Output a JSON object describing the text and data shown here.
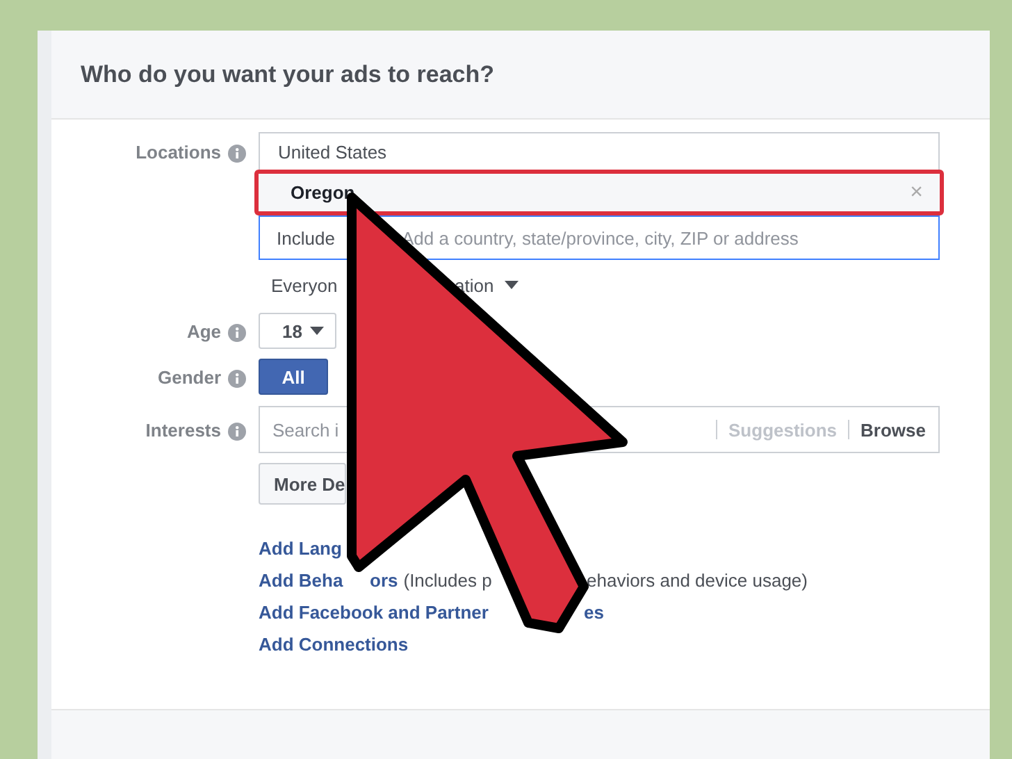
{
  "header": {
    "title": "Who do you want your ads to reach?"
  },
  "locations": {
    "label": "Locations",
    "country": "United States",
    "selected_location": {
      "name": "Oregon",
      "remove": "×",
      "highlighted": true
    },
    "include_select": "Include",
    "placeholder": "Add a country, state/province, city, ZIP or address",
    "audience_fragments": [
      "Everyon",
      "ation"
    ]
  },
  "age": {
    "label": "Age",
    "min_age": "18"
  },
  "gender": {
    "label": "Gender",
    "options": [
      {
        "label": "All",
        "selected": true
      }
    ]
  },
  "interests": {
    "label": "Interests",
    "placeholder": "Search i",
    "suggestions": "Suggestions",
    "browse": "Browse"
  },
  "more_button": "More De",
  "links": [
    {
      "fragments": [
        {
          "text": "Add Lang",
          "kind": "link"
        }
      ]
    },
    {
      "fragments": [
        {
          "text": "Add Beha",
          "kind": "link"
        },
        {
          "text": "ors",
          "kind": "link"
        },
        {
          "text": "(Includes p",
          "kind": "note"
        },
        {
          "text": "ehaviors and device usage)",
          "kind": "note"
        }
      ]
    },
    {
      "fragments": [
        {
          "text": "Add Facebook and Partner",
          "kind": "link"
        },
        {
          "text": "es",
          "kind": "link"
        }
      ]
    },
    {
      "fragments": [
        {
          "text": "Add Connections",
          "kind": "link"
        }
      ]
    }
  ]
}
